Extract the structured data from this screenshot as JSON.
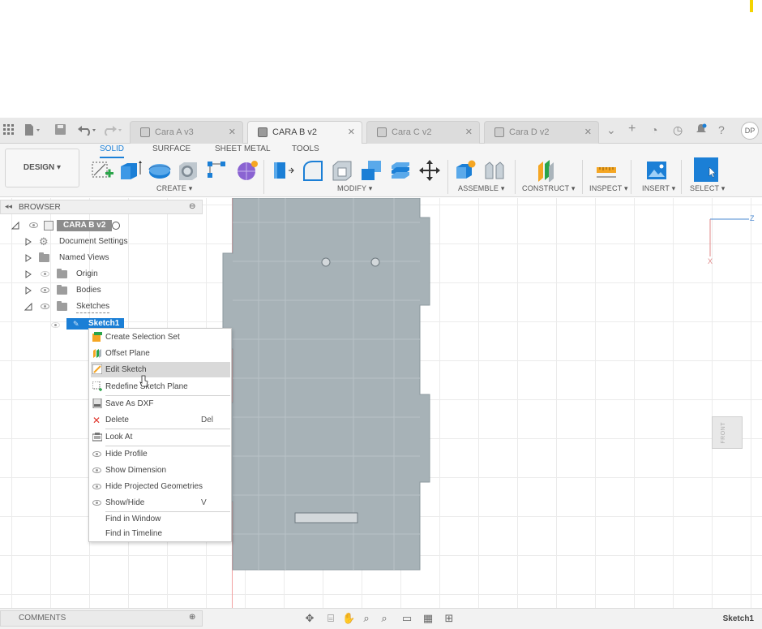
{
  "tabs": [
    {
      "label": "Cara A v3",
      "active": false
    },
    {
      "label": "CARA B v2",
      "active": true
    },
    {
      "label": "Cara C v2",
      "active": false
    },
    {
      "label": "Cara D v2",
      "active": false
    }
  ],
  "user_initials": "DP",
  "toolbar": {
    "workspace": "DESIGN",
    "subtabs": [
      "SOLID",
      "SURFACE",
      "SHEET METAL",
      "TOOLS"
    ],
    "groups": {
      "create": "CREATE",
      "modify": "MODIFY",
      "assemble": "ASSEMBLE",
      "construct": "CONSTRUCT",
      "inspect": "INSPECT",
      "insert": "INSERT",
      "select": "SELECT"
    }
  },
  "browser": {
    "title": "BROWSER",
    "root": "CARA B v2",
    "items": [
      "Document Settings",
      "Named Views",
      "Origin",
      "Bodies",
      "Sketches"
    ],
    "sketch": "Sketch1"
  },
  "context_menu": {
    "items": [
      {
        "label": "Create Selection Set",
        "shortcut": ""
      },
      {
        "label": "Offset Plane",
        "shortcut": ""
      },
      {
        "label": "Edit Sketch",
        "shortcut": ""
      },
      {
        "label": "Redefine Sketch Plane",
        "shortcut": ""
      },
      {
        "label": "Save As DXF",
        "shortcut": ""
      },
      {
        "label": "Delete",
        "shortcut": "Del"
      },
      {
        "label": "Look At",
        "shortcut": ""
      },
      {
        "label": "Hide Profile",
        "shortcut": ""
      },
      {
        "label": "Show Dimension",
        "shortcut": ""
      },
      {
        "label": "Hide Projected Geometries",
        "shortcut": ""
      },
      {
        "label": "Show/Hide",
        "shortcut": "V"
      },
      {
        "label": "Find in Window",
        "shortcut": ""
      },
      {
        "label": "Find in Timeline",
        "shortcut": ""
      }
    ]
  },
  "viewcube": {
    "face": "FRONT",
    "axis_z": "Z",
    "axis_x": "X"
  },
  "comments": {
    "title": "COMMENTS"
  },
  "status_right": "Sketch1",
  "colors": {
    "accent": "#1b7fd6",
    "part": "#a7b2b7",
    "menu_highlight": "#d9d9d9"
  }
}
